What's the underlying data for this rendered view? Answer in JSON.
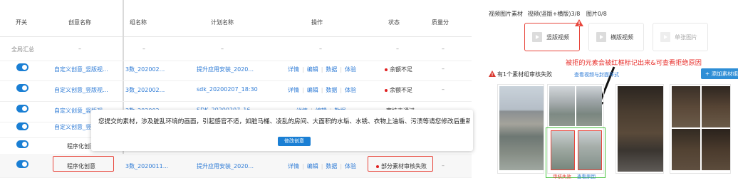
{
  "table": {
    "headers": {
      "switch": "开关",
      "creative_name": "创意名称",
      "group_name": "组名称",
      "plan_name": "计划名称",
      "actions": "操作",
      "status": "状态",
      "quality": "质量分"
    },
    "summary": {
      "label": "全局汇总",
      "c1": "–",
      "c2": "–",
      "c3": "–",
      "c4": "–",
      "c5": "–",
      "c6": "–"
    },
    "rows": [
      {
        "creative": "自定义创意_竖版视...",
        "group": "3数_202002...",
        "plan": "提升应用安装_2020...",
        "actions": [
          "详情",
          "编辑",
          "数据",
          "体验"
        ],
        "status": "余额不足",
        "quality": "–"
      },
      {
        "creative": "自定义创意_竖版视...",
        "group": "3数_202002...",
        "plan": "sdk_20200207_18:30",
        "actions": [
          "详情",
          "编辑",
          "数据",
          "体验"
        ],
        "status": "余额不足",
        "quality": "–"
      },
      {
        "creative": "自定义创意_竖版视...",
        "group": "3数_202002...",
        "plan": "SDK_20200207_16...",
        "actions": [
          "详情",
          "编辑",
          "数据"
        ],
        "status": "审核未通过",
        "quality": "–"
      },
      {
        "creative": "自定义创意_竖版",
        "group": "",
        "plan": "",
        "actions": [],
        "status": "",
        "quality": ""
      },
      {
        "creative": "程序化创意",
        "group": "",
        "plan": "",
        "actions": [],
        "status": "",
        "quality": ""
      },
      {
        "creative": "程序化创意",
        "group": "3数_2020011...",
        "plan": "提升应用安装_2020...",
        "actions": [
          "详情",
          "编辑",
          "数据",
          "体验"
        ],
        "status": "部分素材审核失败",
        "quality": "–"
      }
    ]
  },
  "tooltip": {
    "message": "您提交的素材，涉及脏乱环境的画面，引起感官不适，如脏马桶、凌乱的房间、大面积的水垢、水锈、衣物上油垢、污渍等请您修改后重新提交",
    "button": "修改创意"
  },
  "right": {
    "top_label": "视频图片素材",
    "video_count": "视频(竖版+横版)3/8",
    "image_count": "图片0/8",
    "types": [
      "竖版视频",
      "横版视频",
      "单张图片"
    ],
    "annotation": "被拒的元素会被红框标记出来&可查看拒绝原因",
    "fail_text": "有1个素材组审核失败",
    "fail_link": "查看视频与封面样式",
    "add_button": "+ 添加素材组",
    "captions": {
      "failed": "审核失败",
      "reason": "查看原因"
    }
  },
  "colors": {
    "accent": "#1a7fd4",
    "error": "#e8473d",
    "ok": "#47c23e"
  }
}
